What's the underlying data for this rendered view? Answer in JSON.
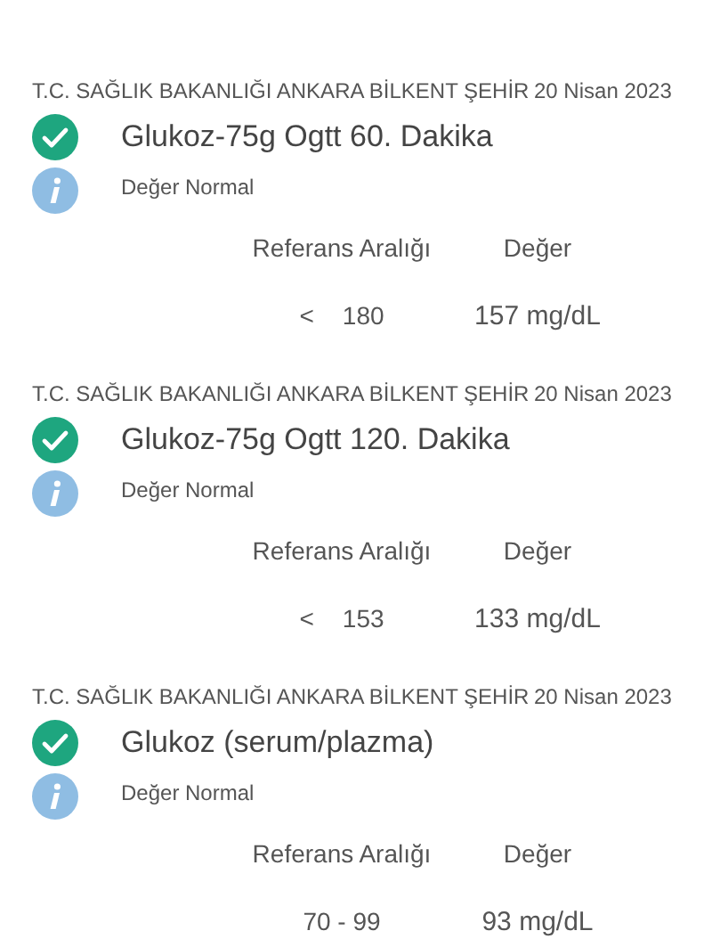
{
  "results": [
    {
      "institution": "T.C. SAĞLIK BAKANLIĞI ANKARA BİLKENT ŞEHİR",
      "date": "20 Nisan 2023",
      "test": "Glukoz-75g Ogtt 60. Dakika",
      "status": "Değer Normal",
      "reference_label": "Referans Aralığı",
      "value_label": "Değer",
      "operator": "<",
      "reference": "180",
      "value": "157 mg/dL"
    },
    {
      "institution": "T.C. SAĞLIK BAKANLIĞI ANKARA BİLKENT ŞEHİR",
      "date": "20 Nisan 2023",
      "test": "Glukoz-75g Ogtt 120. Dakika",
      "status": "Değer Normal",
      "reference_label": "Referans Aralığı",
      "value_label": "Değer",
      "operator": "<",
      "reference": "153",
      "value": "133 mg/dL"
    },
    {
      "institution": "T.C. SAĞLIK BAKANLIĞI ANKARA BİLKENT ŞEHİR",
      "date": "20 Nisan 2023",
      "test": "Glukoz (serum/plazma)",
      "status": "Değer Normal",
      "reference_label": "Referans Aralığı",
      "value_label": "Değer",
      "reference": "70 - 99",
      "value": "93 mg/dL"
    }
  ]
}
